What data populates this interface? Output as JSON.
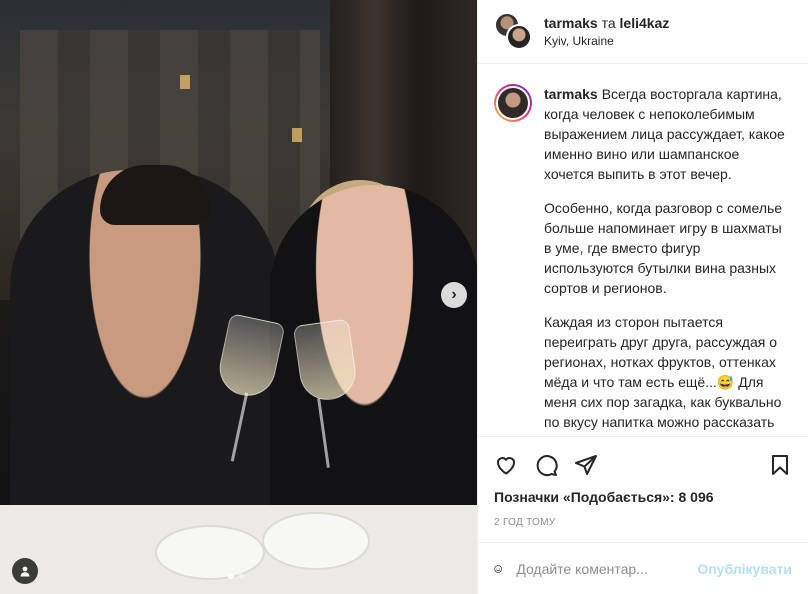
{
  "header": {
    "user1": "tarmaks",
    "separator": "та",
    "user2": "leli4kaz",
    "location": "Kyiv, Ukraine"
  },
  "caption": {
    "username": "tarmaks",
    "paragraphs": [
      "Всегда восторгала картина, когда человек с непоколебимым выражением лица рассуждает, какое именно вино или шампанское хочется выпить в этот вечер.",
      "Особенно, когда разговор с сомелье больше напоминает игру в шахматы в уме, где вместо фигур используются бутылки вина разных сортов и регионов.",
      "Каждая из сторон пытается переиграть друг друга, рассуждая о регионах, нотках фруктов, оттенках мёда и что там есть ещё...😅 Для меня сих пор загадка, как буквально по вкусу напитка можно рассказать практически всю его «родословную»!"
    ]
  },
  "actions": {
    "likes": "Позначки «Подобається»: 8 096",
    "time": "2 год тому"
  },
  "comment_box": {
    "placeholder": "Додайте коментар...",
    "post_label": "Опублікувати"
  },
  "photo": {
    "carousel_total": 2,
    "carousel_active": 1
  },
  "icons": [
    "heart-icon",
    "comment-icon",
    "share-icon",
    "bookmark-icon",
    "emoji-icon",
    "user-tag-icon",
    "chevron-right-icon"
  ],
  "colors": {
    "post_button": "#b2dffc",
    "secondary_text": "#8e8e8e",
    "text": "#262626"
  }
}
